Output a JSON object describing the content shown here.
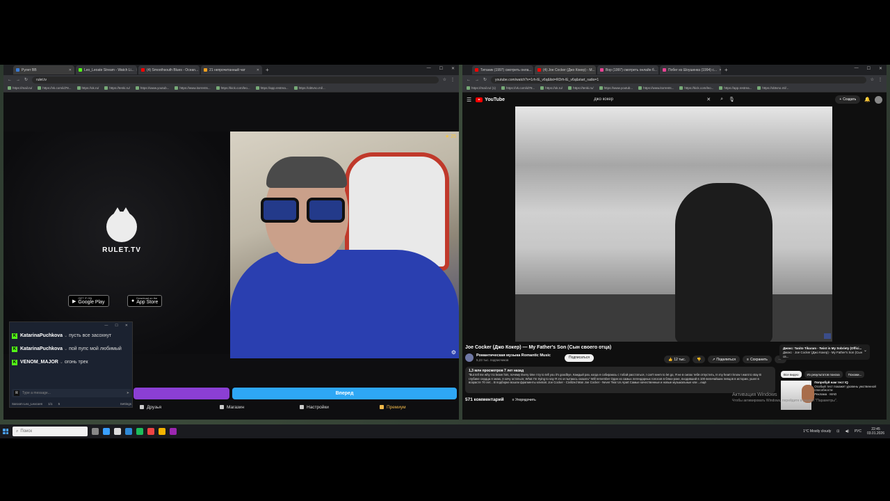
{
  "left_browser": {
    "tabs": [
      {
        "title": "Рулет ВВ",
        "color": "#3b7bd4",
        "active": true
      },
      {
        "title": "Leo_Leoate Stream - Watch Li...",
        "color": "#53fc18",
        "active": false
      },
      {
        "title": "(4) Smoothsouth Blues - Ocean...",
        "color": "#ff0000",
        "active": false
      },
      {
        "title": "21 непрочитанный чат",
        "color": "#f0a020",
        "active": false
      }
    ],
    "url": "rulet.tv",
    "bookmarks": [
      "https://mail.ru/",
      "https://vk.com/id78...",
      "https://ok.ru/",
      "https://tenki.ru/",
      "https://www.youtub...",
      "https://www.itorrents...",
      "https://kick.com/leo...",
      "https://app.restrea...",
      "https://obtvno.ml/..."
    ]
  },
  "rulet": {
    "logo_text": "RULET.TV",
    "google_play": {
      "small": "GET IT ON",
      "label": "Google Play"
    },
    "app_store": {
      "small": "Download on the",
      "label": "App Store"
    },
    "cam_counter": "★ 25",
    "blue_button": "Вперед",
    "nav": [
      {
        "label": "Друзья"
      },
      {
        "label": "Магазин"
      },
      {
        "label": "Настройки"
      },
      {
        "label": "Премиум"
      }
    ]
  },
  "chat": {
    "messages": [
      {
        "user": "KatarinaPuchkova",
        "text": "пусть все засохнут"
      },
      {
        "user": "KatarinaPuchkova",
        "text": "пой пупс мой любимый"
      },
      {
        "user": "VENOM_MAJOR",
        "text": "огонь трек"
      }
    ],
    "input_placeholder": "Type a message...",
    "footer_user": "Saroom Leo_Leocoen",
    "footer_count": "1/1",
    "footer_viewers": "5",
    "footer_extra": "Settings"
  },
  "right_browser": {
    "tabs": [
      {
        "title": "Титаник (1997) смотреть онла...",
        "color": "#ff0000",
        "active": false
      },
      {
        "title": "(4) Joe Cocker (Джо Кокер) - M...",
        "color": "#ff0000",
        "active": true
      },
      {
        "title": "Вор (1997) смотреть онлайн б...",
        "color": "#e84393",
        "active": false
      },
      {
        "title": "Побег из Шоушенка (1994) с...",
        "color": "#e84393",
        "active": false
      }
    ],
    "url": "youtube.com/watch?v=1rh-lE_v6q&list=RDrh-lE_v6q&start_radio=1",
    "bookmarks": [
      "https://mail.ru/ (1)",
      "https://vk.com/id78...",
      "https://ok.ru/",
      "https://tenki.ru/",
      "https://www.youtub...",
      "https://www.itorrents...",
      "https://kick.com/leo...",
      "https://app.restrea...",
      "https://obtvno.ml/..."
    ]
  },
  "youtube": {
    "logo": "YouTube",
    "search_query": "джо кокер",
    "create_label": "Создать",
    "video_title": "Joe Cocker (Джо Кокер) — My Father's Son (Сын своего отца)",
    "channel_name": "Романтическая музыка Romantic Music",
    "channel_subs": "5,23 тыс. подписчиков",
    "subscribe_label": "Подписаться",
    "likes": "12 тыс.",
    "share_label": "Поделиться",
    "save_label": "Сохранить",
    "desc_meta": "1,3 млн просмотров  7 лет назад",
    "desc_text": "\"But tell me why I to leave him, почему Every time I try to tell you it's goodbye, Каждый раз, когда я собираюсь с тобой расстаться, I can't seem to let go, Я не в силах тебя отпустить, In my heart I know I want to stay В глубине сердца я знаю, я хочу остаться, What I'm trying to say Я это и пытаюсь сказать\" Will remember Один из самых легендарных голосов в блюз-роке, входивший в 100 величайших певцов в истории, ушел в возрасте 70 лет... В подборке вошли фрагменты клипов: Joe Cocker - Civilized Man Joe Cocker - Never Tear Us Apart Самые качественные и новые музыкальные кли ...ещё",
    "comments_count": "571 комментарий",
    "sort_label": "Упорядочить",
    "mix_title": "Джокс: Tanito Tikaram - Twist in My Sobriety (Offici...",
    "mix_sub": "Джокс · Joe Cocker (Джо Кокер) - My Father's Son (Сын св...",
    "chips": [
      "Все видео",
      "Из результатов поиска",
      "Похожи..."
    ],
    "rec_title": "Попробуй нам тест IQ",
    "rec_sub": "Особый тест покажет уровень умственной способности",
    "rec_channel": "Реклама · MAD",
    "activation_title": "Активация Windows",
    "activation_sub": "Чтобы активировать Windows, перейдите в раздел \"Параметры\"."
  },
  "taskbar": {
    "search_placeholder": "Поиск",
    "weather": "1°C  Mostly cloudy",
    "lang": "РУС",
    "time": "22:45",
    "date": "03.01.2026"
  }
}
